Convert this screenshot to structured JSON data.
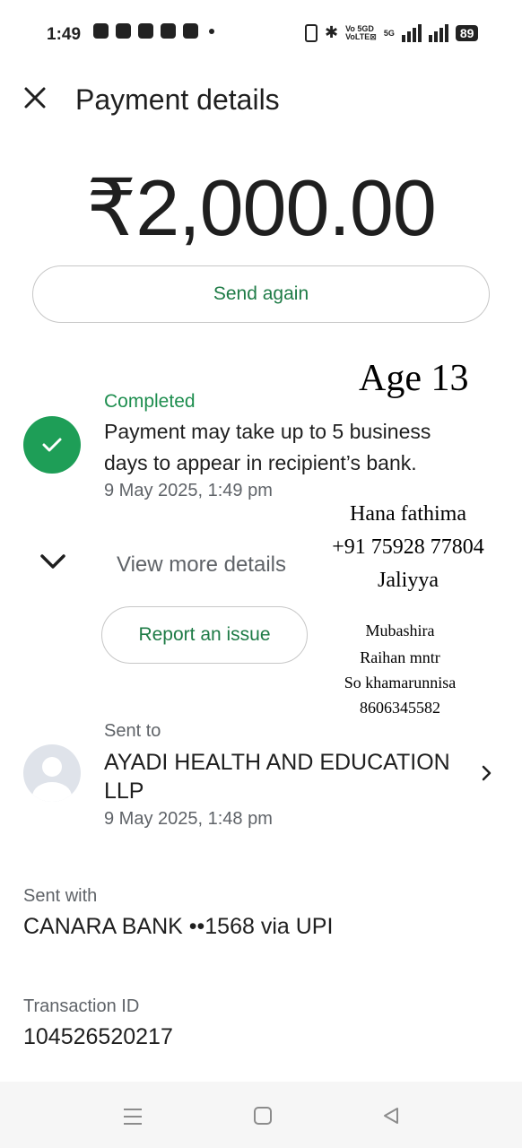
{
  "status_bar": {
    "time": "1:49",
    "volte_top": "Vo 5GD",
    "volte_bottom": "VoLTE⊠",
    "network": "5G",
    "battery": "89"
  },
  "header": {
    "title": "Payment details"
  },
  "amount": "₹2,000.00",
  "send_again_label": "Send again",
  "status": {
    "label": "Completed",
    "message": "Payment may take up to 5 business days to appear in recipient’s bank.",
    "time": "9 May 2025, 1:49 pm"
  },
  "view_more_label": "View more details",
  "report_label": "Report an issue",
  "sent_to": {
    "label": "Sent to",
    "name": "AYADI HEALTH AND EDUCATION LLP",
    "time": "9 May 2025, 1:48 pm"
  },
  "sent_with": {
    "label": "Sent with",
    "value": "CANARA BANK ••1568 via UPI"
  },
  "transaction": {
    "label": "Transaction ID",
    "value": "104526520217"
  },
  "overlay": {
    "age": "Age 13",
    "name": "Hana fathima",
    "phone": "+91 75928 77804",
    "place": "Jaliyya",
    "line1": "Mubashira",
    "line2": "Raihan mntr",
    "line3": "So khamarunnisa",
    "line4": "8606345582"
  },
  "colors": {
    "accent_green": "#1e7b46",
    "check_green": "#1e9e57",
    "text_secondary": "#5f6368"
  }
}
